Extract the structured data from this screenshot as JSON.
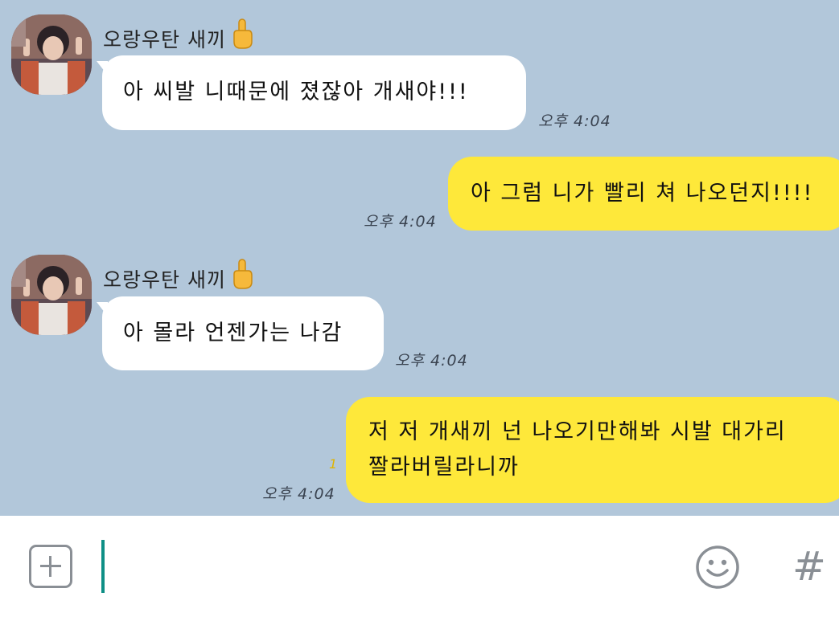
{
  "contact": {
    "name": "오랑우탄 새끼",
    "name_emoji": "middle-finger-icon"
  },
  "messages": [
    {
      "direction": "incoming",
      "text": "아 씨발 니때문에 졌잖아 개새야!!!",
      "time": "오후 4:04"
    },
    {
      "direction": "outgoing",
      "text": "아 그럼 니가 빨리 쳐 나오던지!!!!",
      "time": "오후 4:04"
    },
    {
      "direction": "incoming",
      "text": "아 몰라 언젠가는 나감",
      "time": "오후 4:04"
    },
    {
      "direction": "outgoing",
      "line1": "저 저 개새끼 넌 나오기만해봐 시발 대가리",
      "line2": "짤라버릴라니까",
      "time": "오후 4:04",
      "unread": "1"
    }
  ],
  "input_bar": {
    "placeholder": "",
    "hash_label": "#"
  },
  "colors": {
    "chat_background": "#b2c7da",
    "outgoing_bubble": "#fee83a",
    "incoming_bubble": "#ffffff",
    "caret": "#0e8f86"
  }
}
